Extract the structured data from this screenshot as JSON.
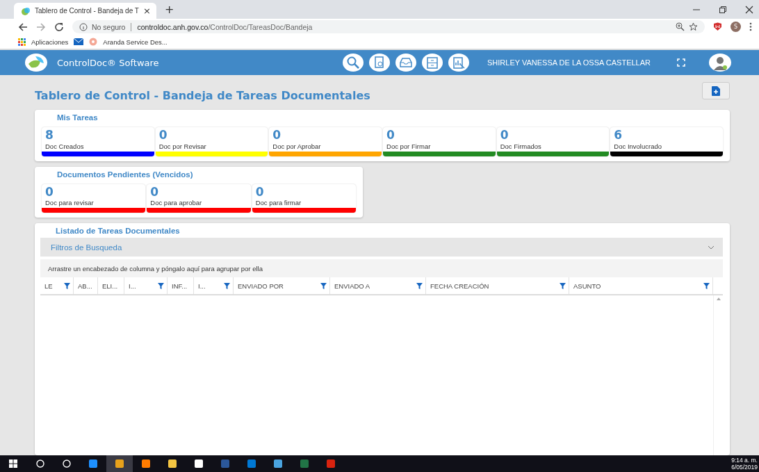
{
  "browser": {
    "tab_title": "Tablero de Control - Bandeja de T",
    "tab_close": "×",
    "new_tab": "+",
    "security": "No seguro",
    "url_host": "controldoc.anh.gov.co",
    "url_path": "/ControlDoc/TareasDoc/Bandeja",
    "profile_initial": "S",
    "bookmarks": [
      "Aplicaciones",
      "Aranda Service Des..."
    ]
  },
  "app": {
    "brand": "ControlDoc® Software",
    "user": "SHIRLEY VANESSA DE LA OSSA CASTELLAR"
  },
  "page_title": "Tablero de Control - Bandeja de Tareas Documentales",
  "mis_tareas": {
    "title": "Mis Tareas",
    "cards": [
      {
        "count": "8",
        "label": "Doc Creados",
        "color": "#0000ff"
      },
      {
        "count": "0",
        "label": "Doc por Revisar",
        "color": "#ffff00"
      },
      {
        "count": "0",
        "label": "Doc por Aprobar",
        "color": "#ffa500"
      },
      {
        "count": "0",
        "label": "Doc por Firmar",
        "color": "#228b22"
      },
      {
        "count": "0",
        "label": "Doc Firmados",
        "color": "#228b22"
      },
      {
        "count": "6",
        "label": "Doc Involucrado",
        "color": "#000000"
      }
    ]
  },
  "pendientes": {
    "title": "Documentos Pendientes (Vencidos)",
    "cards": [
      {
        "count": "0",
        "label": "Doc para revisar",
        "color": "#ff0000"
      },
      {
        "count": "0",
        "label": "Doc para aprobar",
        "color": "#ff0000"
      },
      {
        "count": "0",
        "label": "Doc para firmar",
        "color": "#ff0000"
      }
    ]
  },
  "listado": {
    "title": "Listado de Tareas Documentales",
    "filters": {
      "title": "Filtros de Busqueda",
      "expanded": false
    },
    "group_hint": "Arrastre un encabezado de columna y póngalo aquí para agrupar por ella",
    "columns": [
      {
        "label": "LE",
        "filter": true
      },
      {
        "label": "AB...",
        "filter": false
      },
      {
        "label": "ELI...",
        "filter": false
      },
      {
        "label": "I...",
        "filter": true
      },
      {
        "label": "INF...",
        "filter": false
      },
      {
        "label": "I...",
        "filter": true
      },
      {
        "label": "ENVIADO POR",
        "filter": true
      },
      {
        "label": "ENVIADO A",
        "filter": true
      },
      {
        "label": "FECHA CREACIÓN",
        "filter": true
      },
      {
        "label": "ASUNTO",
        "filter": true
      }
    ]
  },
  "taskbar": {
    "time": "9:14 a. m.",
    "date": "6/05/2019"
  }
}
